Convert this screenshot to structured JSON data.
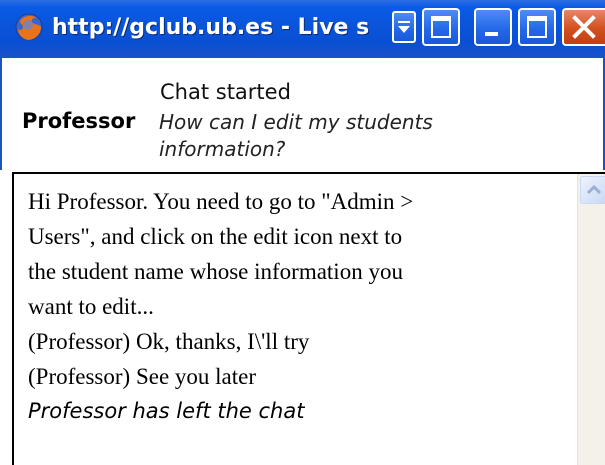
{
  "window": {
    "title": "http://gclub.ub.es - Live s",
    "icon": "firefox-globe-icon"
  },
  "header": {
    "status": "Chat started",
    "sender": "Professor",
    "question": "How can I edit my students information?"
  },
  "transcript": {
    "lines": [
      "Hi Professor. You need to go to \"Admin >",
      "Users\", and click on the edit icon next to",
      "the student name whose information you",
      "want to edit...",
      "(Professor) Ok, thanks, I\\'ll try",
      "(Professor) See you later"
    ],
    "system_message": "Professor has left the chat"
  },
  "colors": {
    "titlebar": "#0a55db",
    "close_button": "#d2501e"
  }
}
